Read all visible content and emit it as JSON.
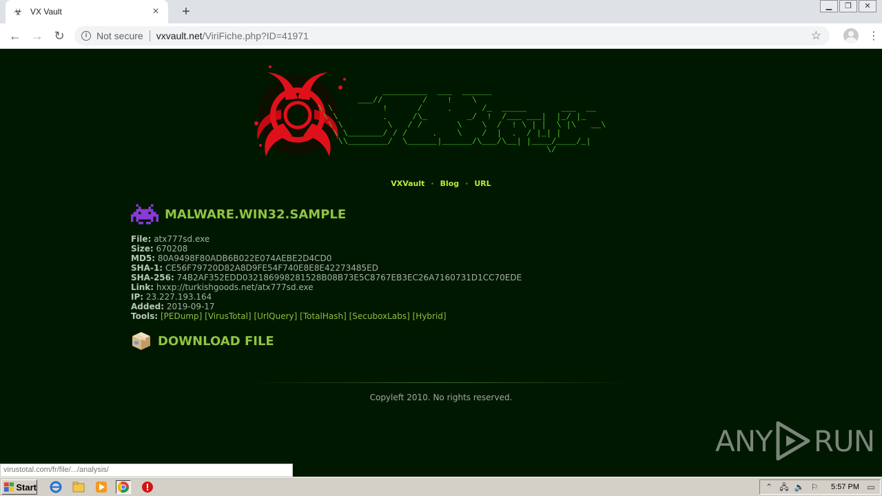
{
  "browser": {
    "tab_title": "VX Vault",
    "url_security": "Not secure",
    "url_host": "vxvault.net",
    "url_path": "/ViriFiche.php?ID=41971",
    "status_url": "virustotal.com/fr/file/.../analysis/"
  },
  "nav": {
    "items": [
      "VXVault",
      "Blog",
      "URL"
    ],
    "separator": "·"
  },
  "sample": {
    "heading": "MALWARE.WIN32.SAMPLE",
    "file_label": "File:",
    "file": "atx777sd.exe",
    "size_label": "Size:",
    "size": "670208",
    "md5_label": "MD5:",
    "md5": "80A9498F80ADB6B022E074AEBE2D4CD0",
    "sha1_label": "SHA-1:",
    "sha1": "CE56F79720D82A8D9FE54F740E8E8E42273485ED",
    "sha256_label": "SHA-256:",
    "sha256": "74B2AF352EDD032186998281528B08B73E5C8767EB3EC26A7160731D1CC70EDE",
    "link_label": "Link:",
    "link": "hxxp://turkishgoods.net/atx777sd.exe",
    "ip_label": "IP:",
    "ip": "23.227.193.164",
    "added_label": "Added:",
    "added": "2019-09-17",
    "tools_label": "Tools:",
    "tools": [
      "[PEDump]",
      "[VirusTotal]",
      "[UrlQuery]",
      "[TotalHash]",
      "[SecuboxLabs]",
      "[Hybrid]"
    ]
  },
  "download": {
    "label": "DOWNLOAD FILE"
  },
  "footer": {
    "text": "Copyleft 2010. No rights reserved."
  },
  "watermark": {
    "left": "ANY",
    "right": "RUN"
  },
  "taskbar": {
    "start_label": "Start",
    "clock": "5:57 PM"
  },
  "colors": {
    "page_bg": "#001800",
    "accent_green": "#8fc444",
    "ascii_green": "#4fbf2a",
    "logo_red": "#e0101a"
  }
}
